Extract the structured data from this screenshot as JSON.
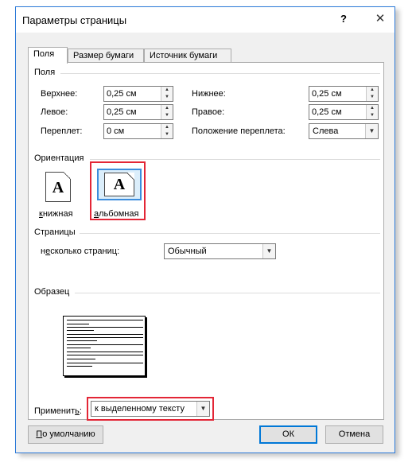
{
  "window": {
    "title": "Параметры страницы",
    "help": "?",
    "close": "✕"
  },
  "tabs": [
    {
      "label": "Поля",
      "active": true
    },
    {
      "label": "Размер бумаги",
      "active": false
    },
    {
      "label": "Источник бумаги",
      "active": false
    }
  ],
  "margins": {
    "section_label": "Поля",
    "top": {
      "label": "Верхнее:",
      "value": "0,25 см"
    },
    "bottom": {
      "label": "Нижнее:",
      "value": "0,25 см"
    },
    "left": {
      "label": "Левое:",
      "value": "0,25 см"
    },
    "right": {
      "label": "Правое:",
      "value": "0,25 см"
    },
    "gutter": {
      "label": "Переплет:",
      "value": "0 см"
    },
    "gutter_position": {
      "label": "Положение переплета:",
      "value": "Слева"
    }
  },
  "orientation": {
    "section_label": "Ориентация",
    "portrait_label": "книжная",
    "landscape_label": "альбомная",
    "icon_letter": "A",
    "selected": "landscape"
  },
  "pages": {
    "section_label": "Страницы",
    "multiple_label": "несколько страниц:",
    "multiple_value": "Обычный"
  },
  "preview": {
    "section_label": "Образец"
  },
  "apply": {
    "label": "Применить:",
    "value": "к выделенному тексту"
  },
  "buttons": {
    "default": "По умолчанию",
    "ok": "ОК",
    "cancel": "Отмена"
  },
  "colors": {
    "highlight": "#e32636",
    "accent": "#0078d7"
  }
}
